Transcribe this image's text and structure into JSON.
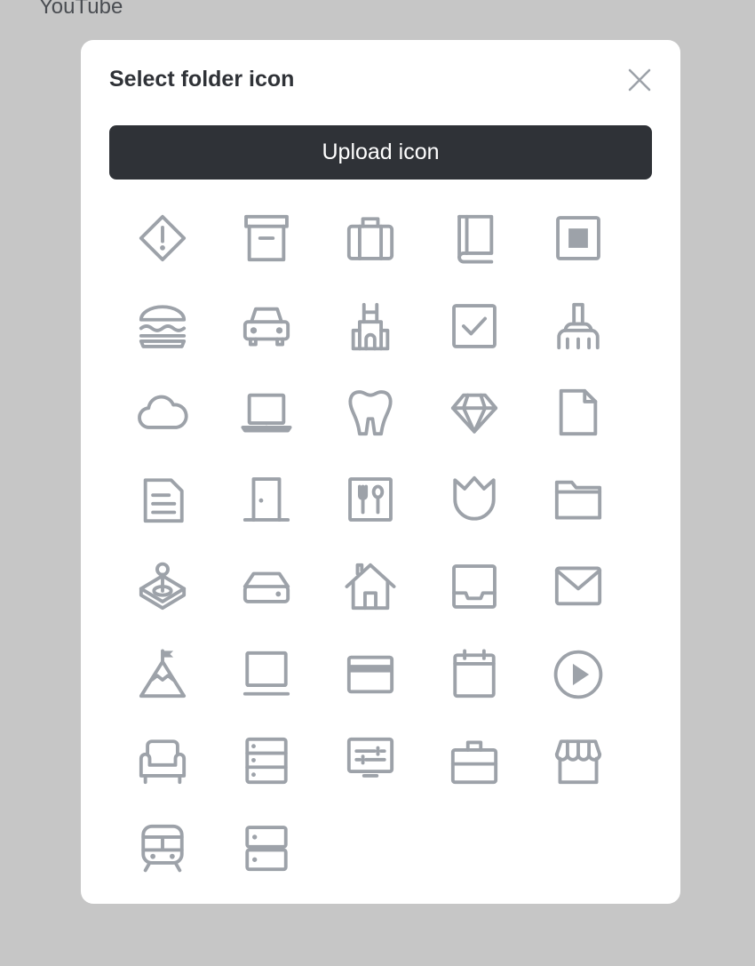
{
  "background": {
    "label": "YouTube"
  },
  "dialog": {
    "title": "Select folder icon",
    "upload_label": "Upload icon"
  },
  "icons": [
    "warning-diamond-icon",
    "archive-box-icon",
    "briefcase-icon",
    "book-icon",
    "stop-square-icon",
    "burger-icon",
    "car-icon",
    "castle-icon",
    "checkbox-icon",
    "broom-icon",
    "cloud-icon",
    "laptop-icon",
    "tooth-icon",
    "diamond-icon",
    "file-icon",
    "document-icon",
    "door-icon",
    "restaurant-icon",
    "tulip-icon",
    "folder-icon",
    "joystick-icon",
    "drive-icon",
    "house-icon",
    "inbox-icon",
    "mail-icon",
    "mountain-flag-icon",
    "computer-icon",
    "credit-card-icon",
    "calendar-icon",
    "play-circle-icon",
    "sofa-icon",
    "server-icon",
    "monitor-settings-icon",
    "toolbox-icon",
    "store-icon",
    "train-icon",
    "server-small-icon"
  ],
  "colors": {
    "backdrop": "#c6c6c6",
    "dialog": "#ffffff",
    "button": "#2f3237",
    "icon": "#9da2a9"
  }
}
